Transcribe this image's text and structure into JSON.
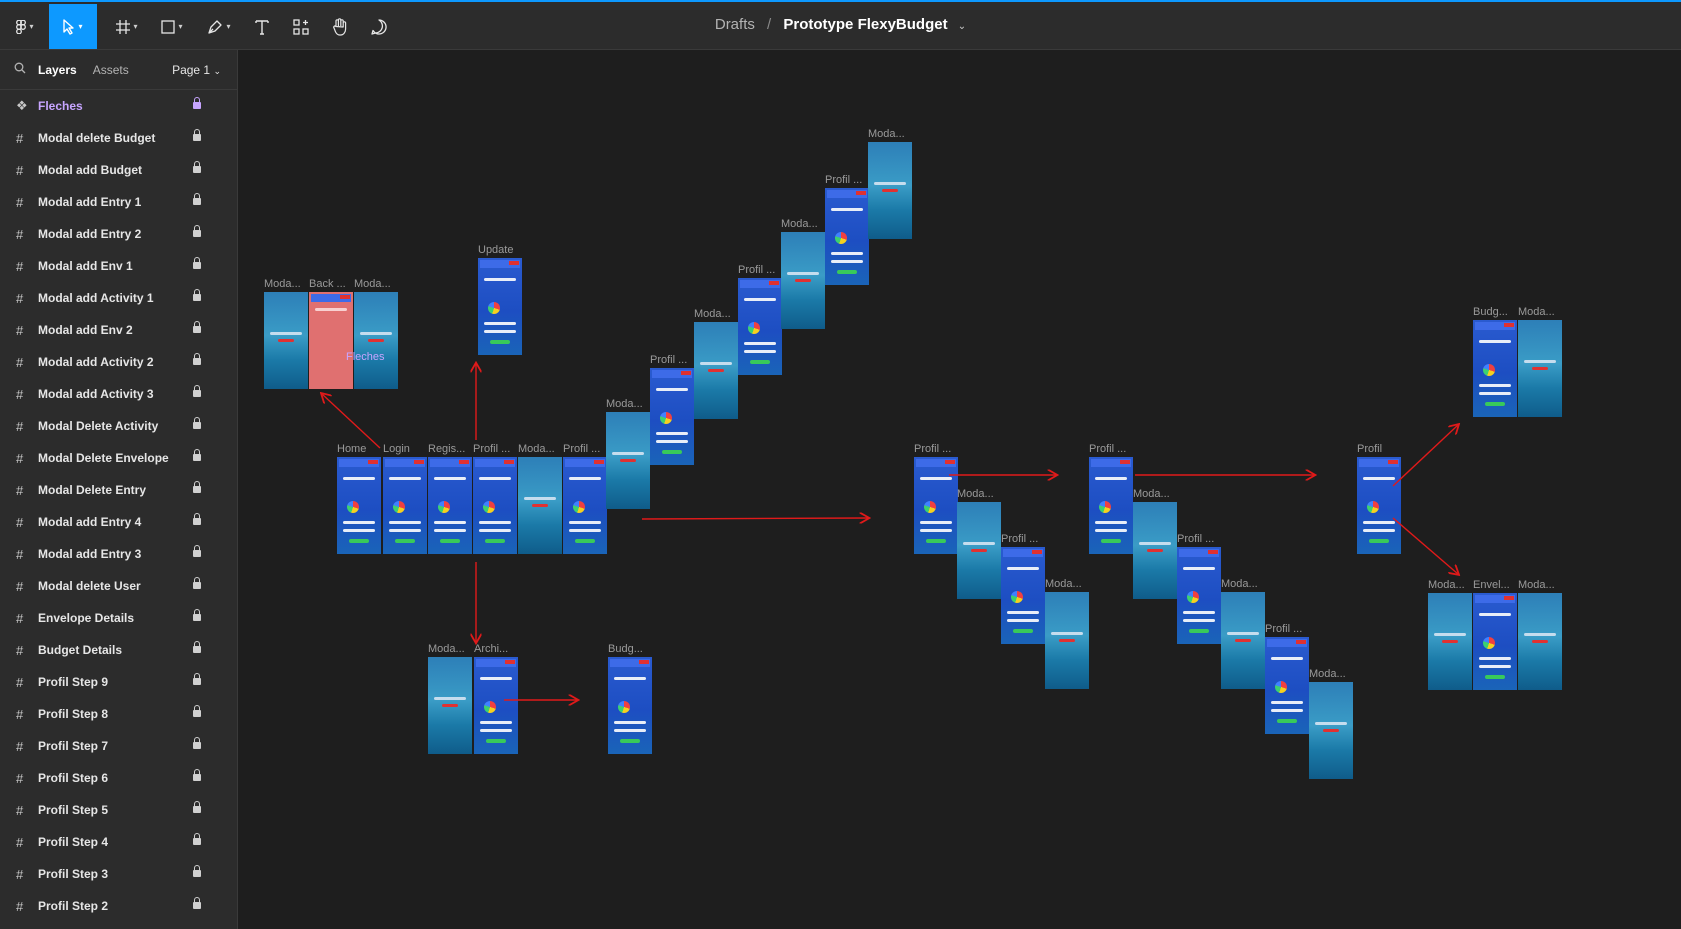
{
  "toolbar": {
    "tools": [
      "figma-menu",
      "move",
      "frame",
      "shape",
      "pen",
      "text",
      "resources",
      "hand",
      "comment"
    ],
    "active_tool": "move"
  },
  "breadcrumb": {
    "folder": "Drafts",
    "separator": "/",
    "file": "Prototype FlexyBudget"
  },
  "sidebar": {
    "tab_layers": "Layers",
    "tab_assets": "Assets",
    "page": "Page 1",
    "layers": [
      {
        "label": "Fleches",
        "kind": "component"
      },
      {
        "label": "Modal delete Budget",
        "kind": "frame"
      },
      {
        "label": "Modal add Budget",
        "kind": "frame"
      },
      {
        "label": "Modal add Entry 1",
        "kind": "frame"
      },
      {
        "label": "Modal add Entry 2",
        "kind": "frame"
      },
      {
        "label": "Modal add Env 1",
        "kind": "frame"
      },
      {
        "label": "Modal add Activity 1",
        "kind": "frame"
      },
      {
        "label": "Modal add Env 2",
        "kind": "frame"
      },
      {
        "label": "Modal add Activity 2",
        "kind": "frame"
      },
      {
        "label": "Modal add Activity 3",
        "kind": "frame"
      },
      {
        "label": "Modal Delete Activity",
        "kind": "frame"
      },
      {
        "label": "Modal Delete Envelope",
        "kind": "frame"
      },
      {
        "label": "Modal Delete Entry",
        "kind": "frame"
      },
      {
        "label": "Modal add Entry 4",
        "kind": "frame"
      },
      {
        "label": "Modal add Entry 3",
        "kind": "frame"
      },
      {
        "label": "Modal delete User",
        "kind": "frame"
      },
      {
        "label": "Envelope Details",
        "kind": "frame"
      },
      {
        "label": "Budget Details",
        "kind": "frame"
      },
      {
        "label": "Profil Step 9",
        "kind": "frame"
      },
      {
        "label": "Profil Step 8",
        "kind": "frame"
      },
      {
        "label": "Profil Step 7",
        "kind": "frame"
      },
      {
        "label": "Profil Step 6",
        "kind": "frame"
      },
      {
        "label": "Profil Step 5",
        "kind": "frame"
      },
      {
        "label": "Profil Step 4",
        "kind": "frame"
      },
      {
        "label": "Profil Step 3",
        "kind": "frame"
      },
      {
        "label": "Profil Step 2",
        "kind": "frame"
      }
    ]
  },
  "canvas": {
    "fleches_label": "Fleches",
    "arrow_color": "#e01a1a",
    "frames": [
      {
        "label": "Moda...",
        "style": "modal"
      },
      {
        "label": "Back ...",
        "style": "red"
      },
      {
        "label": "Moda...",
        "style": "modal"
      },
      {
        "label": "Update",
        "style": "app"
      },
      {
        "label": "Home",
        "style": "app"
      },
      {
        "label": "Login",
        "style": "app"
      },
      {
        "label": "Regis...",
        "style": "app"
      },
      {
        "label": "Profil ...",
        "style": "app"
      },
      {
        "label": "Moda...",
        "style": "modal"
      },
      {
        "label": "Profil ...",
        "style": "app"
      },
      {
        "label": "Moda...",
        "style": "modal"
      },
      {
        "label": "Profil ...",
        "style": "app"
      },
      {
        "label": "Moda...",
        "style": "modal"
      },
      {
        "label": "Profil ...",
        "style": "app"
      },
      {
        "label": "Moda...",
        "style": "modal"
      },
      {
        "label": "Profil ...",
        "style": "app"
      },
      {
        "label": "Moda...",
        "style": "modal"
      },
      {
        "label": "Moda...",
        "style": "modal"
      },
      {
        "label": "Archi...",
        "style": "app"
      },
      {
        "label": "Budg...",
        "style": "app"
      },
      {
        "label": "Profil ...",
        "style": "app"
      },
      {
        "label": "Moda...",
        "style": "modal"
      },
      {
        "label": "Profil ...",
        "style": "app"
      },
      {
        "label": "Moda...",
        "style": "modal"
      },
      {
        "label": "Profil ...",
        "style": "app"
      },
      {
        "label": "Moda...",
        "style": "modal"
      },
      {
        "label": "Profil ...",
        "style": "app"
      },
      {
        "label": "Moda...",
        "style": "modal"
      },
      {
        "label": "Profil ...",
        "style": "app"
      },
      {
        "label": "Moda...",
        "style": "modal"
      },
      {
        "label": "Profil",
        "style": "app"
      },
      {
        "label": "Budg...",
        "style": "app"
      },
      {
        "label": "Moda...",
        "style": "modal"
      },
      {
        "label": "Moda...",
        "style": "modal"
      },
      {
        "label": "Envel...",
        "style": "app"
      },
      {
        "label": "Moda...",
        "style": "modal"
      }
    ]
  }
}
